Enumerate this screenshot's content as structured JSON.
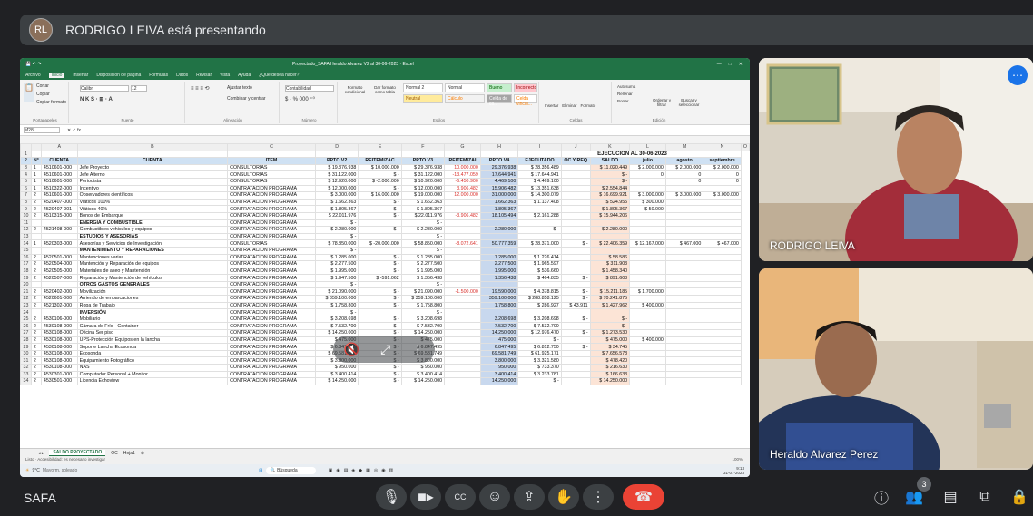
{
  "presenter": {
    "banner": "RODRIGO LEIVA está presentando",
    "avatar_initials": "RL"
  },
  "excel": {
    "window_title": "Proyectado_SAFA Heraldo Alvarez V2 al 30-06-2023 · Excel",
    "menu": [
      "Archivo",
      "Inicio",
      "Insertar",
      "Disposición de página",
      "Fórmulas",
      "Datos",
      "Revisar",
      "Vista",
      "Ayuda",
      "¿Qué desea hacer?"
    ],
    "ribbon": {
      "font_name": "Calibri",
      "font_size": "12",
      "wrap_text": "Ajustar texto",
      "merge": "Combinar y centrar",
      "number_format": "Contabilidad",
      "cond_format": "Formato condicional",
      "format_table": "Dar formato como tabla",
      "styles": [
        "Normal 2",
        "Normal",
        "Bueno",
        "Incorrecto",
        "Neutral",
        "Cálculo",
        "Celda de co...",
        "Celda vincul..."
      ],
      "cells": [
        "Insertar",
        "Eliminar",
        "Formato"
      ],
      "edit": [
        "Autosuma",
        "Rellenar",
        "Borrar",
        "Ordenar y filtrar",
        "Buscar y seleccionar"
      ],
      "groups": [
        "Portapapeles",
        "Fuente",
        "Alineación",
        "Número",
        "Estilos",
        "Celdas",
        "Edición"
      ],
      "clipboard": [
        "Cortar",
        "Copiar",
        "Copiar formato"
      ]
    },
    "name_box": "M28",
    "columns": [
      "A",
      "B",
      "C",
      "D",
      "E",
      "F",
      "G",
      "H",
      "I",
      "J",
      "K",
      "L",
      "M",
      "N",
      "O"
    ],
    "exec_title": "EJECUCION AL 30-06-2023",
    "headers": [
      "N°",
      "CUENTA",
      "CUENTA",
      "ITEM",
      "PPTO V2",
      "REITEMIZAC",
      "PPTO V3",
      "REITEMIZAI",
      "PPTO V4",
      "EJECUTADO",
      "OC Y REQ",
      "SALDO",
      "julio",
      "agosto",
      "septiembre"
    ],
    "rows": [
      [
        "1",
        "4510601-000",
        "Jefe Proyecto",
        "CONSULTORIAS",
        "$ 19.376.938",
        "$ 10.000.000",
        "$ 29.376.938",
        "10.000.000",
        "29.376.938",
        "$ 28.356.489",
        "",
        "$ 11.020.449",
        "$ 2.000.000",
        "$ 2.000.000",
        "$ 2.000.000"
      ],
      [
        "1",
        "4510601-000",
        "Jefe Alterno",
        "CONSULTORIAS",
        "$ 31.122.000",
        "$ -",
        "$ 31.122.000",
        "-13.477.059",
        "17.644.941",
        "$ 17.644.941",
        "",
        "$ -",
        "0",
        "0",
        "0"
      ],
      [
        "1",
        "4510601-000",
        "Periodista",
        "CONSULTORIAS",
        "$ 12.920.000",
        "$ -2.000.000",
        "$ 10.920.000",
        "-6.450.900",
        "4.469.100",
        "$ 4.469.100",
        "",
        "$ -",
        "",
        "0",
        "0"
      ],
      [
        "1",
        "4510322-000",
        "Incentivo",
        "CONTRATACION PROGRAMA",
        "$ 12.000.000",
        "$ -",
        "$ 12.000.000",
        "3.906.482",
        "15.906.482",
        "$ 13.351.638",
        "",
        "$ 2.554.844",
        "",
        "",
        ""
      ],
      [
        "2",
        "4510601-000",
        "Observadores científicos",
        "CONTRATACION PROGRAMA",
        "$ 3.000.000",
        "$ 16.000.000",
        "$ 19.000.000",
        "12.000.000",
        "31.000.000",
        "$ 14.300.079",
        "",
        "$ 16.699.921",
        "$ 3.000.000",
        "$ 3.000.000",
        "$ 3.000.000"
      ],
      [
        "2",
        "4520407-000",
        "Viáticos 100%",
        "CONTRATACION PROGRAMA",
        "$ 1.662.363",
        "$ -",
        "$ 1.662.363",
        "",
        "1.662.363",
        "$ 1.137.408",
        "",
        "$ 524.955",
        "$ 300.000",
        "",
        ""
      ],
      [
        "2",
        "4520407-001",
        "Viáticos 40%",
        "CONTRATACION PROGRAMA",
        "$ 1.805.367",
        "$ -",
        "$ 1.805.367",
        "",
        "1.805.367",
        "",
        "",
        "$ 1.805.367",
        "$ 50.000",
        "",
        ""
      ],
      [
        "2",
        "4510315-000",
        "Bonos de Embarque",
        "CONTRATACION PROGRAMA",
        "$ 22.011.976",
        "$ -",
        "$ 22.011.976",
        "-3.906.482",
        "18.105.494",
        "$ 2.161.288",
        "",
        "$ 15.944.206",
        "",
        "",
        ""
      ],
      [
        "",
        "",
        "ENERGÍA Y COMBUSTIBLE",
        "CONTRATACION PROGRAMA",
        "$ -",
        "",
        "$ -",
        "",
        "",
        "",
        "",
        "",
        "",
        "",
        ""
      ],
      [
        "2",
        "4521408-000",
        "Combustibles vehiculos y equipos",
        "CONTRATACION PROGRAMA",
        "$ 2.280.000",
        "$ -",
        "$ 2.280.000",
        "",
        "2.280.000",
        "$ -",
        "",
        "$ 2.280.000",
        "",
        "",
        ""
      ],
      [
        "",
        "",
        "ESTUDIOS Y ASESORÍAS",
        "CONTRATACION PROGRAMA",
        "$ -",
        "",
        "$ -",
        "",
        "",
        "",
        "",
        "",
        "",
        "",
        ""
      ],
      [
        "1",
        "4520303-000",
        "Asesorías y Servicios de Investigación",
        "CONSULTORIAS",
        "$ 78.850.000",
        "$ -20.000.000",
        "$ 58.850.000",
        "-8.072.641",
        "50.777.359",
        "$ 28.371.000",
        "$ -",
        "$ 22.406.359",
        "$ 12.167.000",
        "$ 467.000",
        "$ 467.000"
      ],
      [
        "",
        "",
        "MANTENIMIENTO Y REPARACIONES",
        "CONTRATACION PROGRAMA",
        "$ -",
        "",
        "$ -",
        "",
        "",
        "",
        "",
        "",
        "",
        "",
        ""
      ],
      [
        "2",
        "4520501-000",
        "Mantenciones varias",
        "CONTRATACION PROGRAMA",
        "$ 1.285.000",
        "$ -",
        "$ 1.285.000",
        "",
        "1.285.000",
        "$ 1.226.414",
        "",
        "$ 58.586",
        "",
        "",
        ""
      ],
      [
        "2",
        "4520504-000",
        "Mantención y Reparación de equipos",
        "CONTRATACION PROGRAMA",
        "$ 2.277.500",
        "$ -",
        "$ 2.277.500",
        "",
        "2.277.500",
        "$ 1.965.597",
        "",
        "$ 311.903",
        "",
        "",
        ""
      ],
      [
        "2",
        "4520505-000",
        "Materiales de aseo y Mantención",
        "CONTRATACION PROGRAMA",
        "$ 1.995.000",
        "$ -",
        "$ 1.995.000",
        "",
        "1.995.000",
        "$ 536.660",
        "",
        "$ 1.458.340",
        "",
        "",
        ""
      ],
      [
        "2",
        "4520507-000",
        "Reparación y Mantención de vehículos",
        "CONTRATACION PROGRAMA",
        "$ 1.947.500",
        "$ -591.062",
        "$ 1.356.438",
        "",
        "1.356.438",
        "$ 464.835",
        "$ -",
        "$ 891.603",
        "",
        "",
        ""
      ],
      [
        "",
        "",
        "OTROS GASTOS GENERALES",
        "CONTRATACION PROGRAMA",
        "$ -",
        "",
        "$ -",
        "",
        "",
        "",
        "",
        "",
        "",
        "",
        ""
      ],
      [
        "2",
        "4520402-000",
        "Movilización",
        "CONTRATACION PROGRAMA",
        "$ 21.090.000",
        "$ -",
        "$ 21.090.000",
        "-1.500.000",
        "19.590.000",
        "$ 4.378.815",
        "$ -",
        "$ 15.211.185",
        "$ 1.700.000",
        "",
        ""
      ],
      [
        "2",
        "4520601-000",
        "Arriendo de embarcaciones",
        "CONTRATACION PROGRAMA",
        "$ 359.100.000",
        "$ -",
        "$ 359.100.000",
        "",
        "359.100.000",
        "$ 288.858.125",
        "$ -",
        "$ 70.241.875",
        "",
        "",
        ""
      ],
      [
        "2",
        "4521302-000",
        "Ropa de Trabajo",
        "CONTRATACION PROGRAMA",
        "$ 1.758.800",
        "$ -",
        "$ 1.758.800",
        "",
        "1.758.800",
        "$ 286.927",
        "$ 43.911",
        "$ 1.427.962",
        "$ 400.000",
        "",
        ""
      ],
      [
        "",
        "",
        "INVERSIÓN",
        "CONTRATACION PROGRAMA",
        "$ -",
        "",
        "$ -",
        "",
        "",
        "",
        "",
        "",
        "",
        "",
        ""
      ],
      [
        "2",
        "4530106-000",
        "Mobiliario",
        "CONTRATACION PROGRAMA",
        "$ 3.208.698",
        "$ -",
        "$ 3.208.698",
        "",
        "3.208.698",
        "$ 3.208.698",
        "$ -",
        "$ -",
        "",
        "",
        ""
      ],
      [
        "2",
        "4530108-000",
        "Cámara de Frío - Container",
        "CONTRATACION PROGRAMA",
        "$ 7.532.700",
        "$ -",
        "$ 7.532.700",
        "",
        "7.532.700",
        "$ 7.532.700",
        "",
        "$ -",
        "",
        "",
        ""
      ],
      [
        "2",
        "4530108-000",
        "Oficina Ser piso",
        "CONTRATACION PROGRAMA",
        "$ 14.250.000",
        "$ -",
        "$ 14.250.000",
        "",
        "14.250.000",
        "$ 12.976.470",
        "$ -",
        "$ 1.273.530",
        "",
        "",
        ""
      ],
      [
        "2",
        "4530108-000",
        "UPS-Protección Equipos en la lancha",
        "CONTRATACION PROGRAMA",
        "$ 475.000",
        "$ -",
        "$ 475.000",
        "",
        "475.000",
        "$ -",
        "",
        "$ 475.000",
        "$ 400.000",
        "",
        ""
      ],
      [
        "2",
        "4530108-000",
        "Soporte Lancha Ecosonda",
        "CONTRATACION PROGRAMA",
        "$ 6.847.495",
        "$ -",
        "$ 6.847.495",
        "",
        "6.847.495",
        "$ 6.812.750",
        "$ -",
        "$ 34.745",
        "",
        "",
        ""
      ],
      [
        "2",
        "4530108-000",
        "Ecosonda",
        "CONTRATACION PROGRAMA",
        "$ 69.581.749",
        "$ -",
        "$ 69.581.749",
        "",
        "69.581.749",
        "$ 61.925.171",
        "",
        "$ 7.656.578",
        "",
        "",
        ""
      ],
      [
        "2",
        "4530108-000",
        "Equipamiento Fotográfico",
        "CONTRATACION PROGRAMA",
        "$ 3.800.000",
        "$ -",
        "$ 3.800.000",
        "",
        "3.800.000",
        "$ 3.321.580",
        "",
        "$ 478.420",
        "",
        "",
        ""
      ],
      [
        "2",
        "4530108-000",
        "NAS",
        "CONTRATACION PROGRAMA",
        "$ 950.000",
        "$ -",
        "$ 950.000",
        "",
        "950.000",
        "$ 733.370",
        "",
        "$ 216.630",
        "",
        "",
        ""
      ],
      [
        "2",
        "4530301-000",
        "Computador Personal + Monitor",
        "CONTRATACION PROGRAMA",
        "$ 3.400.414",
        "$ -",
        "$ 3.400.414",
        "",
        "3.400.414",
        "$ 3.233.781",
        "",
        "$ 166.633",
        "",
        "",
        ""
      ],
      [
        "2",
        "4530501-000",
        "Licencia Echoview",
        "CONTRATACION PROGRAMA",
        "$ 14.250.000",
        "$ -",
        "$ 14.250.000",
        "",
        "14.250.000",
        "$ -",
        "",
        "$ 14.250.000",
        "",
        "",
        ""
      ]
    ],
    "sheet_tabs": [
      "SALDO PROYECTADO",
      "OC",
      "Hoja1"
    ],
    "status_text": "Listo · Accesibilidad: es necesario investigar",
    "taskbar": {
      "weather_temp": "9°C",
      "weather_desc": "Mayorm. soleado",
      "search": "Búsqueda",
      "time": "9:13",
      "date": "31-07-2023"
    },
    "zoom": "100%"
  },
  "participants": [
    {
      "name": "RODRIGO LEIVA"
    },
    {
      "name": "Heraldo Alvarez Perez"
    }
  ],
  "bottom": {
    "meeting_name": "SAFA",
    "participant_count": "3"
  }
}
